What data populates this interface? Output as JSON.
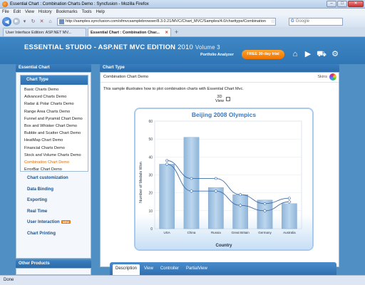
{
  "window": {
    "title": "Essential Chart : Combination Charts Demo : Syncfusion - Mozilla Firefox"
  },
  "menu": [
    "File",
    "Edit",
    "View",
    "History",
    "Bookmarks",
    "Tools",
    "Help"
  ],
  "navbar": {
    "url": "http://samples.syncfusion.com/sfmvcsamplebrowser/8.3.0.21/MVC/Chart_MVC/Samples/4.0/charttype/Combination",
    "search_placeholder": "Google"
  },
  "tabs": [
    {
      "label": "User Interface Edition: ASP.NET MV..."
    },
    {
      "label": "Essential Chart : Combination Char..."
    }
  ],
  "header": {
    "brand": "ESSENTIAL STUDIO - ASP.NET MVC EDITION",
    "year": "2010",
    "volume": "Volume 3",
    "portfolio": "Portfolio Analyzer",
    "trial": "FREE 30-day trial",
    "accent": "#f07200"
  },
  "sidebar": {
    "title": "Essential Chart",
    "chart_type_header": "Chart Type",
    "items": [
      "Basic Charts Demo",
      "Advanced Charts Demo",
      "Radar & Polar Charts Demo",
      "Range Area Charts Demo",
      "Funnel and Pyramid Chart Demo",
      "Box and Whisker Chart Demo",
      "Bubble and Scatter Chart Demo",
      "HeatMap Chart Demo",
      "Financial Charts Demo",
      "Stock and Volume Charts Demo",
      "Combination Chart Demo",
      "ErrorBar Chart Demo"
    ],
    "active_index": 10,
    "sections": [
      "Chart customization",
      "Data Binding",
      "Exporting",
      "Real Time",
      "User Interaction",
      "Chart Printing"
    ],
    "new_badge": "NEW",
    "other_products": "Other Products"
  },
  "main": {
    "header": "Chart Type",
    "demo_title": "Combination Chart Demo",
    "skins": "Skins",
    "description": "This sample illustrates how to plot combination charts with Essential Chart Mvc.",
    "view3d_label": "3D View",
    "bottom_tabs": [
      "Description",
      "View",
      "Controller",
      "PartialView"
    ]
  },
  "chart_data": {
    "type": "bar",
    "title": "Beijing 2008 Olympics",
    "xlabel": "Country",
    "ylabel": "Number of Medals Won",
    "ylim": [
      0,
      60
    ],
    "yticks": [
      0,
      10,
      20,
      30,
      40,
      50,
      60
    ],
    "categories": [
      "USA",
      "China",
      "Russia",
      "Great Britain",
      "Germany",
      "Australia"
    ],
    "series": [
      {
        "type": "bar",
        "values": [
          36,
          51,
          23,
          19,
          16,
          14
        ]
      },
      {
        "type": "line",
        "values": [
          38,
          28,
          28,
          19,
          14,
          17
        ]
      },
      {
        "type": "line",
        "values": [
          36,
          21,
          21,
          13,
          10,
          15
        ]
      }
    ],
    "colors": {
      "bar": "#a5c6e3",
      "line": "#3d6ea8",
      "title": "#3a78c2"
    }
  },
  "status": "Done"
}
